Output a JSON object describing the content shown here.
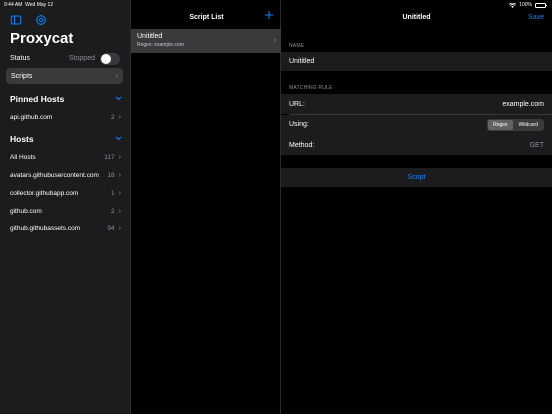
{
  "statusbar": {
    "time": "9:44 AM",
    "date": "Wed May 12",
    "battery": "100%"
  },
  "sidebar": {
    "app_title": "Proxycat",
    "status_label": "Status",
    "status_value": "Stopped",
    "scripts_label": "Scripts",
    "pinned_header": "Pinned Hosts",
    "pinned": [
      {
        "host": "api.github.com",
        "count": "2"
      }
    ],
    "hosts_header": "Hosts",
    "hosts": [
      {
        "host": "All Hosts",
        "count": "117"
      },
      {
        "host": "avatars.githubusercontent.com",
        "count": "18"
      },
      {
        "host": "collector.githubapp.com",
        "count": "1"
      },
      {
        "host": "github.com",
        "count": "2"
      },
      {
        "host": "github.githubassets.com",
        "count": "94"
      }
    ]
  },
  "script_list": {
    "title": "Script List",
    "items": [
      {
        "name": "Unititled",
        "subtitle": "Regex: example.com"
      }
    ]
  },
  "detail": {
    "title": "Unititled",
    "save_label": "Save",
    "name_group": "NAME",
    "name_value": "Unititled",
    "rule_group": "MATCHING RULE",
    "url_label": "URL:",
    "url_value": "example.com",
    "using_label": "Using:",
    "using_options": [
      "Regex",
      "Wildcard"
    ],
    "using_selected": "Regex",
    "method_label": "Method:",
    "method_value": "GET",
    "script_button": "Script"
  },
  "colors": {
    "accent": "#0a84ff",
    "sidebar_bg": "#1c1c1e",
    "selected_bg": "#3a3a3c"
  },
  "icons": {
    "sidebar_toggle": "sidebar-icon",
    "settings": "gear-icon",
    "add": "plus-icon",
    "chevron": "chevron-right-icon",
    "collapse": "chevron-down-icon"
  }
}
